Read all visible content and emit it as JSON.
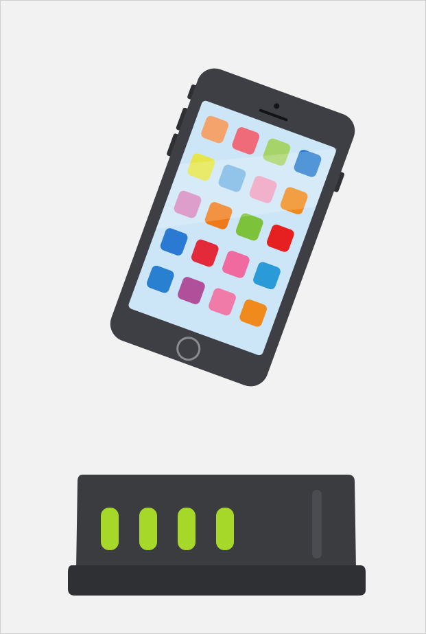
{
  "scene": {
    "background": "#f2f2f2",
    "frame_border": "#cfcfcf"
  },
  "smartphone": {
    "icon": "smartphone-icon",
    "body_color": "#3d3f44",
    "screen_color": "#cde6f7",
    "home_button_ring": "#8a8c91",
    "app_icons": [
      [
        "#f5a36c",
        "#ef6b7a",
        "#a7d46a",
        "#2d7fd0"
      ],
      [
        "#e6e64a",
        "#7ab8e6",
        "#f0a0c0",
        "#f08a1c"
      ],
      [
        "#d689c0",
        "#ef7a1a",
        "#7cc23a",
        "#e62020"
      ],
      [
        "#2a7ad4",
        "#e22a3a",
        "#f06aa0",
        "#2a9ad8"
      ],
      [
        "#2a80d0",
        "#b0509a",
        "#f07aa8",
        "#f08a1c"
      ]
    ]
  },
  "router": {
    "icon": "router-icon",
    "body_color": "#3a3c40",
    "base_color": "#2e3034",
    "led_color": "#a6d82a",
    "led_count": 4
  }
}
